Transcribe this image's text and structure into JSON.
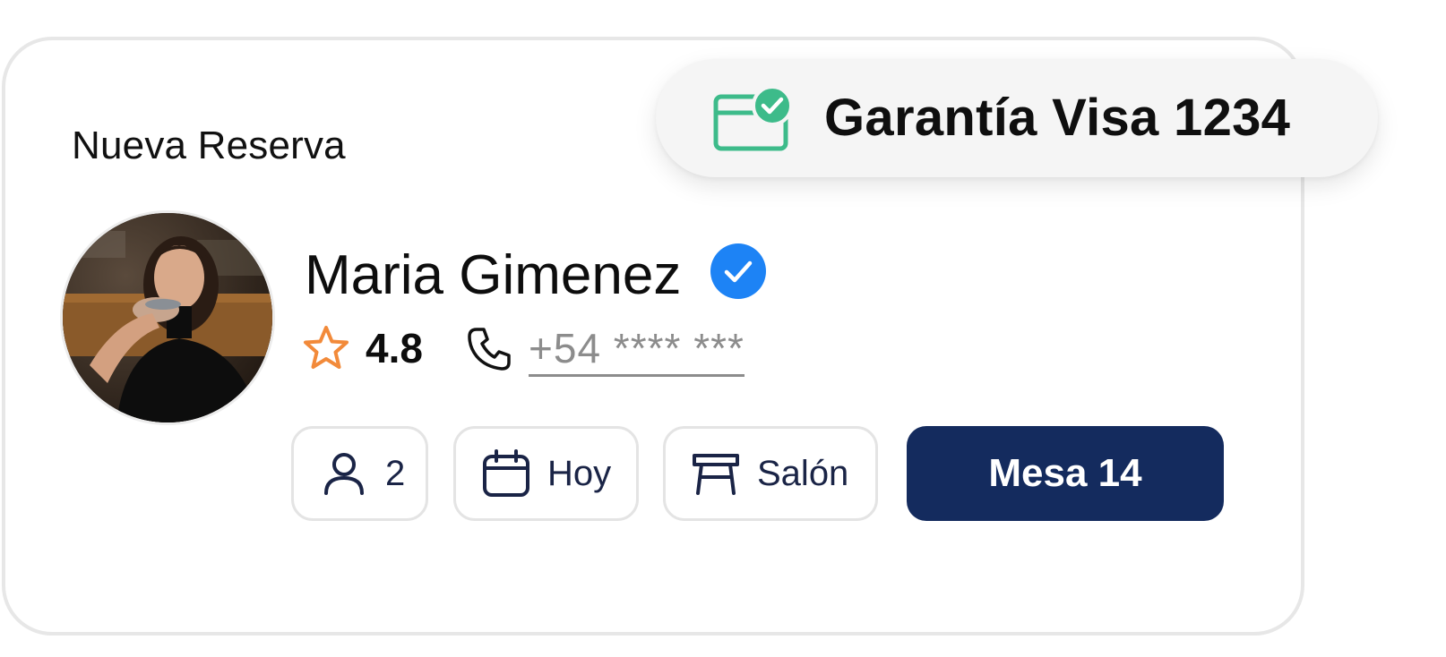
{
  "card": {
    "title": "Nueva Reserva"
  },
  "guarantee": {
    "icon": "credit-card-check-icon",
    "label": "Garantía Visa 1234",
    "color": "#3dbb8a"
  },
  "guest": {
    "name": "Maria Gimenez",
    "verified_icon": "verified-badge-icon",
    "verified_color": "#1d83f5",
    "rating_icon": "star-outline-icon",
    "rating_color": "#f28a3a",
    "rating": "4.8",
    "phone_icon": "phone-icon",
    "phone": "+54 **** ***"
  },
  "details": {
    "party_size_icon": "person-icon",
    "party_size": "2",
    "date_icon": "calendar-icon",
    "date": "Hoy",
    "area_icon": "table-icon",
    "area": "Salón",
    "table_button": "Mesa 14",
    "accent": "#142b5e"
  }
}
